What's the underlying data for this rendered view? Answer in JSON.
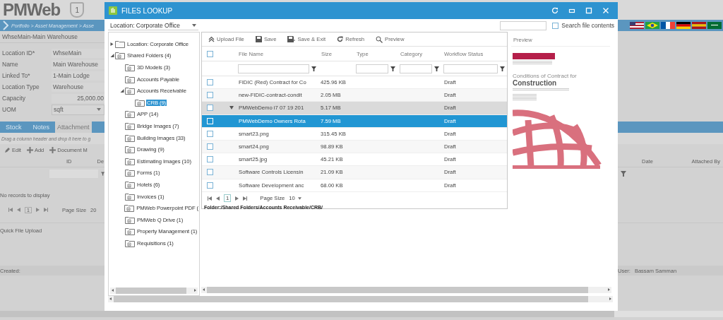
{
  "app": {
    "logo": "PMWeb",
    "badge": "1",
    "breadcrumb": "Portfolio > Asset Management > Asse",
    "record_title": "WhseMain-Main Warehouse",
    "fields": [
      {
        "label": "Location ID*",
        "value": "WhseMain",
        "kind": "text"
      },
      {
        "label": "Name",
        "value": "Main Warehouse",
        "kind": "text"
      },
      {
        "label": "Linked To*",
        "value": "1-Main Lodge",
        "kind": "text"
      },
      {
        "label": "Location Type",
        "value": "Warehouse",
        "kind": "text"
      },
      {
        "label": "Capacity",
        "value": "25,000.00",
        "kind": "number"
      },
      {
        "label": "UOM",
        "value": "sqft",
        "kind": "dropdown"
      }
    ],
    "tabs": [
      {
        "label": "Stock",
        "selected": false
      },
      {
        "label": "Notes",
        "selected": false
      },
      {
        "label": "Attachment",
        "selected": true
      }
    ],
    "group_hint": "Drag a column header and drop it here to g",
    "toolbar": [
      {
        "label": "Edit",
        "kind": "edit"
      },
      {
        "label": "Add",
        "kind": "add"
      },
      {
        "label": "Document M",
        "kind": "add"
      }
    ],
    "columns_left": [
      "ID",
      "De"
    ],
    "columns_right": [
      "Date",
      "Attached By"
    ],
    "empty_message": "No records to display",
    "pager": {
      "page": "1",
      "page_size_label": "Page Size",
      "page_size": "20"
    },
    "quick_upload": "Quick File Upload",
    "created_label": "Created:",
    "user_label": "User:",
    "user": "Bassam Samman"
  },
  "dialog": {
    "title": "FILES LOOKUP",
    "location": "Location: Corporate Office",
    "search_contents": {
      "label": "Search file contents",
      "checked": false
    },
    "tree": [
      {
        "label": "Location: Corporate Office",
        "expanded": false,
        "selected": false
      },
      {
        "label": "Shared Folders (4)",
        "expanded": true,
        "selected": false,
        "children": [
          {
            "label": "3D Models (3)",
            "selected": false
          },
          {
            "label": "Accounts Payable",
            "selected": false
          },
          {
            "label": "Accounts Receivable",
            "expanded": true,
            "selected": false,
            "children": [
              {
                "label": "CRB (9)",
                "selected": true
              }
            ]
          },
          {
            "label": "APP (14)",
            "selected": false
          },
          {
            "label": "Bridge Images (7)",
            "selected": false
          },
          {
            "label": "Building Images (33)",
            "selected": false
          },
          {
            "label": "Drawing (9)",
            "selected": false
          },
          {
            "label": "Estimating Images (10)",
            "selected": false
          },
          {
            "label": "Forms (1)",
            "selected": false
          },
          {
            "label": "Hotels (6)",
            "selected": false
          },
          {
            "label": "Invoices (1)",
            "selected": false
          },
          {
            "label": "PMWeb Powerpoint PDF (",
            "selected": false
          },
          {
            "label": "PMWeb Q Drive (1)",
            "selected": false
          },
          {
            "label": "Property Management (1)",
            "selected": false
          },
          {
            "label": "Requisitions (1)",
            "selected": false
          }
        ]
      }
    ],
    "toolbar": [
      {
        "label": "Upload File",
        "kind": "upload"
      },
      {
        "label": "Save",
        "kind": "save"
      },
      {
        "label": "Save & Exit",
        "kind": "save_exit"
      },
      {
        "label": "Refresh",
        "kind": "refresh"
      },
      {
        "label": "Preview",
        "kind": "preview"
      }
    ],
    "columns": [
      "File Name",
      "Size",
      "Type",
      "Category",
      "Workflow Status"
    ],
    "select_all_checked": false,
    "rows": [
      {
        "kind": "file",
        "file_name": "FIDIC (Red) Contract for Co",
        "size": "425.96 KB",
        "status": "Draft",
        "checked": false,
        "selected": false
      },
      {
        "kind": "file",
        "file_name": "new-FIDIC-contract-condit",
        "size": "2.05 MB",
        "status": "Draft",
        "checked": false,
        "selected": false
      },
      {
        "kind": "group",
        "expanded": true,
        "file_name": "PMWebDemo i7 07 19 201",
        "size": "5.17 MB",
        "status": "Draft",
        "checked": false,
        "selected": false
      },
      {
        "kind": "file",
        "file_name": "PMWebDemo Owners Rota",
        "size": "7.59 MB",
        "status": "Draft",
        "checked": false,
        "selected": true
      },
      {
        "kind": "file",
        "file_name": "smart23.png",
        "size": "315.45 KB",
        "status": "Draft",
        "checked": false,
        "selected": false
      },
      {
        "kind": "file",
        "file_name": "smart24.png",
        "size": "98.89 KB",
        "status": "Draft",
        "checked": false,
        "selected": false
      },
      {
        "kind": "file",
        "file_name": "smart25.jpg",
        "size": "45.21 KB",
        "status": "Draft",
        "checked": false,
        "selected": false
      },
      {
        "kind": "file",
        "file_name": "Software Controls Licensin",
        "size": "21.09 KB",
        "status": "Draft",
        "checked": false,
        "selected": false
      },
      {
        "kind": "file",
        "file_name": "Software Development anc",
        "size": "68.00 KB",
        "status": "Draft",
        "checked": false,
        "selected": false
      }
    ],
    "pager": {
      "page": "1",
      "page_size_label": "Page Size",
      "page_size": "10"
    },
    "folder_path": "Folder:/Shared Folders/Accounts Receivable/CRB/",
    "preview": {
      "label": "Preview",
      "doc_title": "Conditions of Contract for",
      "doc_heading": "Construction"
    }
  }
}
